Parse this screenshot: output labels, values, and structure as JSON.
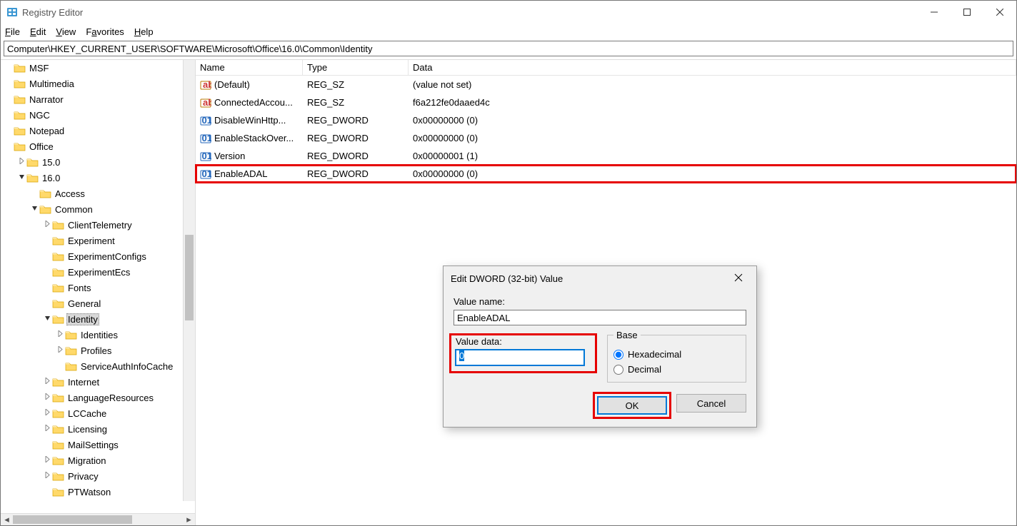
{
  "window": {
    "title": "Registry Editor"
  },
  "menu": {
    "file": "File",
    "edit": "Edit",
    "view": "View",
    "favorites": "Favorites",
    "help": "Help"
  },
  "address": "Computer\\HKEY_CURRENT_USER\\SOFTWARE\\Microsoft\\Office\\16.0\\Common\\Identity",
  "tree": [
    {
      "indent": 1,
      "exp": "",
      "label": "MSF"
    },
    {
      "indent": 1,
      "exp": "",
      "label": "Multimedia"
    },
    {
      "indent": 1,
      "exp": "",
      "label": "Narrator"
    },
    {
      "indent": 1,
      "exp": "",
      "label": "NGC"
    },
    {
      "indent": 1,
      "exp": "",
      "label": "Notepad"
    },
    {
      "indent": 1,
      "exp": "",
      "label": "Office"
    },
    {
      "indent": 2,
      "exp": ">",
      "label": "15.0"
    },
    {
      "indent": 2,
      "exp": "v",
      "label": "16.0"
    },
    {
      "indent": 3,
      "exp": "",
      "label": "Access"
    },
    {
      "indent": 3,
      "exp": "v",
      "label": "Common"
    },
    {
      "indent": 4,
      "exp": ">",
      "label": "ClientTelemetry"
    },
    {
      "indent": 4,
      "exp": "",
      "label": "Experiment"
    },
    {
      "indent": 4,
      "exp": "",
      "label": "ExperimentConfigs"
    },
    {
      "indent": 4,
      "exp": "",
      "label": "ExperimentEcs"
    },
    {
      "indent": 4,
      "exp": "",
      "label": "Fonts"
    },
    {
      "indent": 4,
      "exp": "",
      "label": "General"
    },
    {
      "indent": 4,
      "exp": "v",
      "label": "Identity",
      "selected": true
    },
    {
      "indent": 5,
      "exp": ">",
      "label": "Identities"
    },
    {
      "indent": 5,
      "exp": ">",
      "label": "Profiles"
    },
    {
      "indent": 5,
      "exp": "",
      "label": "ServiceAuthInfoCache"
    },
    {
      "indent": 4,
      "exp": ">",
      "label": "Internet"
    },
    {
      "indent": 4,
      "exp": ">",
      "label": "LanguageResources"
    },
    {
      "indent": 4,
      "exp": ">",
      "label": "LCCache"
    },
    {
      "indent": 4,
      "exp": ">",
      "label": "Licensing"
    },
    {
      "indent": 4,
      "exp": "",
      "label": "MailSettings"
    },
    {
      "indent": 4,
      "exp": ">",
      "label": "Migration"
    },
    {
      "indent": 4,
      "exp": ">",
      "label": "Privacy"
    },
    {
      "indent": 4,
      "exp": "",
      "label": "PTWatson"
    }
  ],
  "values_header": {
    "name": "Name",
    "type": "Type",
    "data": "Data"
  },
  "values": [
    {
      "icon": "sz",
      "name": "(Default)",
      "type": "REG_SZ",
      "data": "(value not set)"
    },
    {
      "icon": "sz",
      "name": "ConnectedAccou...",
      "type": "REG_SZ",
      "data": "f6a212fe0daaed4c"
    },
    {
      "icon": "dword",
      "name": "DisableWinHttp...",
      "type": "REG_DWORD",
      "data": "0x00000000 (0)"
    },
    {
      "icon": "dword",
      "name": "EnableStackOver...",
      "type": "REG_DWORD",
      "data": "0x00000000 (0)"
    },
    {
      "icon": "dword",
      "name": "Version",
      "type": "REG_DWORD",
      "data": "0x00000001 (1)"
    },
    {
      "icon": "dword",
      "name": "EnableADAL",
      "type": "REG_DWORD",
      "data": "0x00000000 (0)",
      "highlight": true
    }
  ],
  "dialog": {
    "title": "Edit DWORD (32-bit) Value",
    "value_name_label": "Value name:",
    "value_name": "EnableADAL",
    "value_data_label": "Value data:",
    "value_data": "0",
    "base_label": "Base",
    "hex_label": "Hexadecimal",
    "dec_label": "Decimal",
    "ok": "OK",
    "cancel": "Cancel"
  }
}
